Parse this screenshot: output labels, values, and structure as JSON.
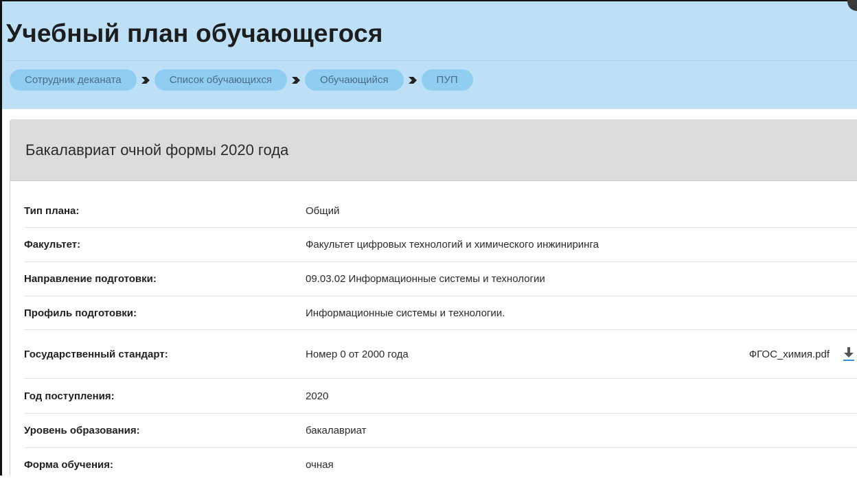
{
  "header": {
    "title": "Учебный план обучающегося",
    "breadcrumb": [
      {
        "label": "Сотрудник деканата"
      },
      {
        "label": "Список обучающихся"
      },
      {
        "label": "Обучающийся"
      },
      {
        "label": "ПУП"
      }
    ]
  },
  "panel": {
    "title": "Бакалавриат очной формы 2020 года",
    "rows": [
      {
        "label": "Тип плана:",
        "value": "Общий"
      },
      {
        "label": "Факультет:",
        "value": "Факультет цифровых технологий и химического инжиниринга"
      },
      {
        "label": "Направление подготовки:",
        "value": "09.03.02 Информационные системы и технологии"
      },
      {
        "label": "Профиль подготовки:",
        "value": "Информационные системы и технологии."
      },
      {
        "label": "Государственный стандарт:",
        "value": "Номер 0 от 2000 года",
        "file": "ФГОС_химия.pdf",
        "file_icon": "download-icon"
      },
      {
        "label": "Год поступления:",
        "value": "2020"
      },
      {
        "label": "Уровень образования:",
        "value": "бакалавриат"
      },
      {
        "label": "Форма обучения:",
        "value": "очная"
      }
    ]
  },
  "colors": {
    "header_bg": "#bde0f7",
    "crumb_bg": "#8fcdf1",
    "crumb_text": "#4e6d84",
    "panel_head_bg": "#dcdcdc"
  }
}
